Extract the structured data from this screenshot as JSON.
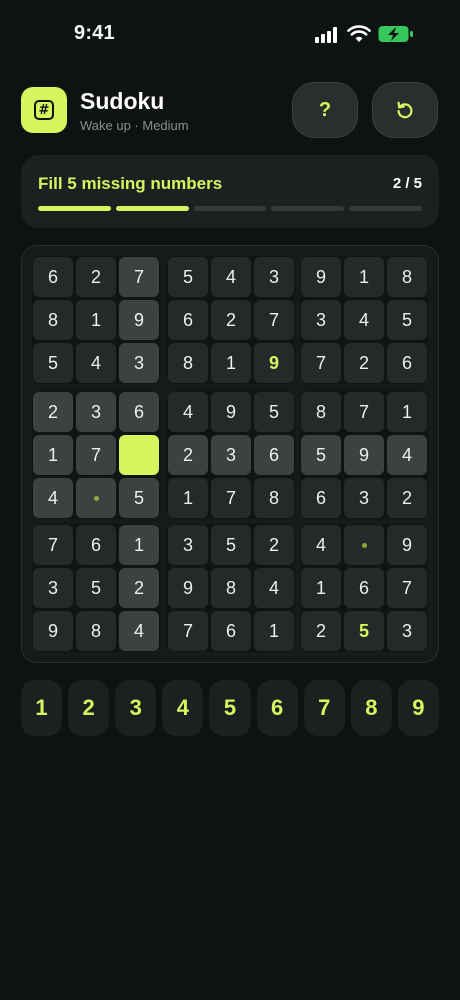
{
  "status": {
    "time": "9:41"
  },
  "header": {
    "title": "Sudoku",
    "subtitle": "Wake up · Medium",
    "icon_glyph": "#",
    "help_label": "?"
  },
  "colors": {
    "accent": "#d6f55f",
    "background": "#0f1213",
    "card": "#1c2021"
  },
  "progress": {
    "label": "Fill 5 missing numbers",
    "count": "2 / 5",
    "filled": 2,
    "total": 5
  },
  "board": {
    "rows": [
      [
        "6",
        "2",
        "7",
        "5",
        "4",
        "3",
        "9",
        "1",
        "8"
      ],
      [
        "8",
        "1",
        "9",
        "6",
        "2",
        "7",
        "3",
        "4",
        "5"
      ],
      [
        "5",
        "4",
        "3",
        "8",
        "1",
        "9",
        "7",
        "2",
        "6"
      ],
      [
        "2",
        "3",
        "6",
        "4",
        "9",
        "5",
        "8",
        "7",
        "1"
      ],
      [
        "1",
        "7",
        "",
        "2",
        "3",
        "6",
        "5",
        "9",
        "4"
      ],
      [
        "4",
        "",
        "5",
        "1",
        "7",
        "8",
        "6",
        "3",
        "2"
      ],
      [
        "7",
        "6",
        "1",
        "3",
        "5",
        "2",
        "4",
        "",
        "9"
      ],
      [
        "3",
        "5",
        "2",
        "9",
        "8",
        "4",
        "1",
        "6",
        "7"
      ],
      [
        "9",
        "8",
        "4",
        "7",
        "6",
        "1",
        "2",
        "5",
        "3"
      ]
    ],
    "selected": [
      4,
      2
    ],
    "user_filled": [
      [
        2,
        5
      ],
      [
        8,
        7
      ]
    ],
    "empty_dots": [
      [
        5,
        1
      ],
      [
        6,
        7
      ]
    ]
  },
  "numpad": [
    "1",
    "2",
    "3",
    "4",
    "5",
    "6",
    "7",
    "8",
    "9"
  ]
}
